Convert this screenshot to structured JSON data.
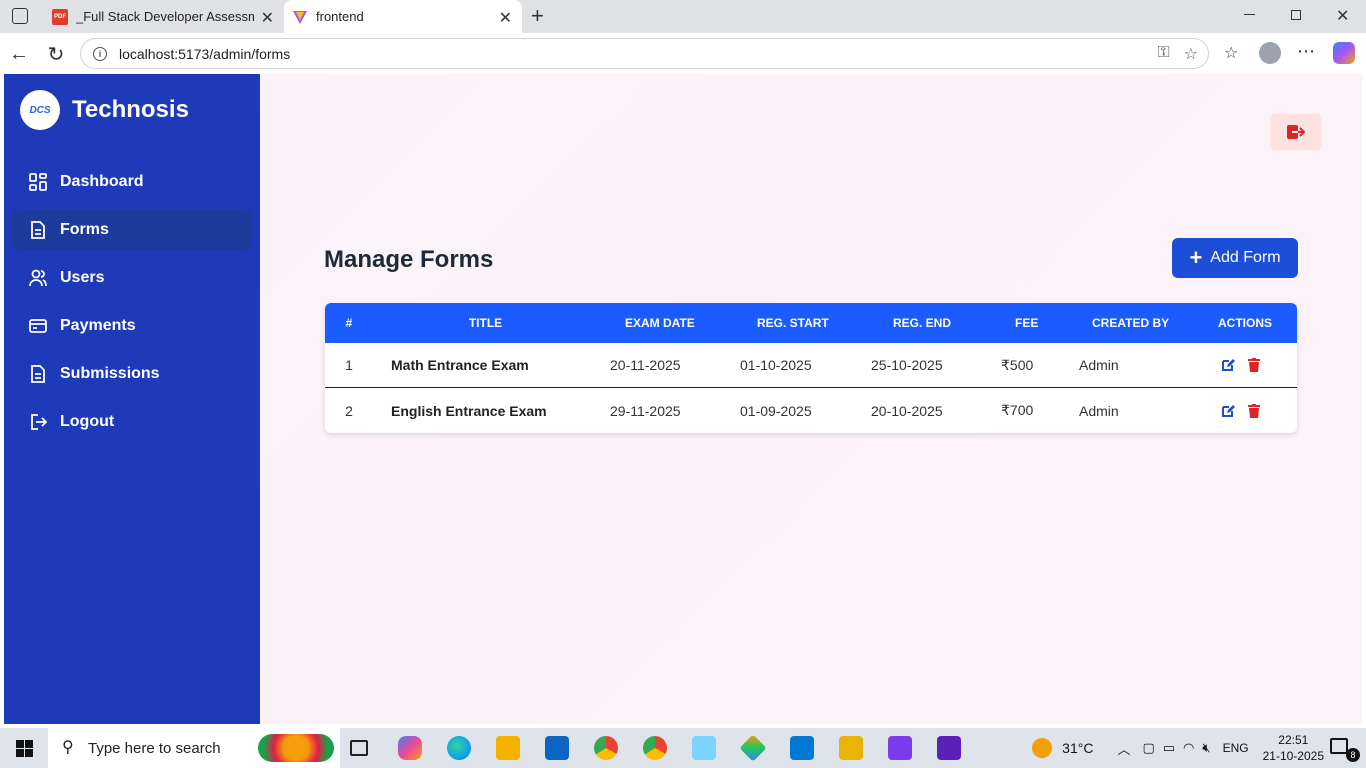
{
  "browser": {
    "tabs": [
      {
        "title": "_Full Stack Developer Assessment",
        "icon": "pdf-icon"
      },
      {
        "title": "frontend",
        "icon": "vite-icon",
        "active": true
      }
    ],
    "url": "localhost:5173/admin/forms"
  },
  "sidebar": {
    "brand": "Technosis",
    "logo_text": "DCS",
    "items": [
      {
        "label": "Dashboard",
        "icon": "dashboard-icon"
      },
      {
        "label": "Forms",
        "icon": "document-icon",
        "active": true
      },
      {
        "label": "Users",
        "icon": "users-icon"
      },
      {
        "label": "Payments",
        "icon": "card-icon"
      },
      {
        "label": "Submissions",
        "icon": "document-icon"
      },
      {
        "label": "Logout",
        "icon": "logout-icon"
      }
    ]
  },
  "main": {
    "title": "Manage Forms",
    "add_button": "Add Form",
    "table": {
      "headers": [
        "#",
        "TITLE",
        "EXAM DATE",
        "REG. START",
        "REG. END",
        "FEE",
        "CREATED BY",
        "ACTIONS"
      ],
      "rows": [
        {
          "num": "1",
          "title": "Math Entrance Exam",
          "exam_date": "20-11-2025",
          "reg_start": "01-10-2025",
          "reg_end": "25-10-2025",
          "fee": "₹500",
          "created_by": "Admin"
        },
        {
          "num": "2",
          "title": "English Entrance Exam",
          "exam_date": "29-11-2025",
          "reg_start": "01-09-2025",
          "reg_end": "20-10-2025",
          "fee": "₹700",
          "created_by": "Admin"
        }
      ]
    }
  },
  "taskbar": {
    "search_placeholder": "Type here to search",
    "weather": "31°C",
    "lang": "ENG",
    "time": "22:51",
    "date": "21-10-2025",
    "notifications": "8"
  },
  "colors": {
    "sidebar": "#1e3ab8",
    "accent": "#1d4ed8",
    "table_header": "#1a5cff",
    "delete": "#dc2626"
  }
}
